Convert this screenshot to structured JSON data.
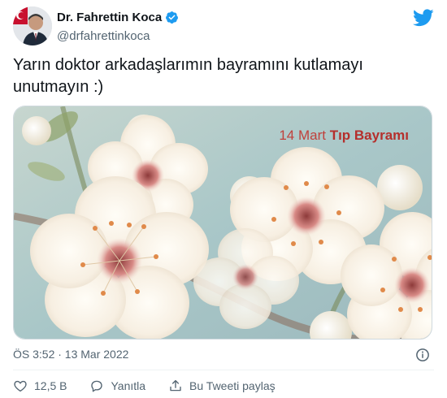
{
  "author": {
    "name": "Dr. Fahrettin Koca",
    "handle": "@drfahrettinkoca"
  },
  "tweet": {
    "text": "Yarın doktor arkadaşlarımın bayramını kutlamayı unutmayın :)"
  },
  "media": {
    "overlay_date": "14 Mart ",
    "overlay_title": "Tıp Bayramı"
  },
  "timestamp": "ÖS 3:52 · 13 Mar 2022",
  "actions": {
    "likes": "12,5 B",
    "reply_label": "Yanıtla",
    "share_label": "Bu Tweeti paylaş"
  },
  "colors": {
    "twitter_blue": "#1d9bf0",
    "text_primary": "#0f1419",
    "text_secondary": "#536471",
    "overlay_red": "#c0413c"
  },
  "icons": [
    "verified-badge-icon",
    "twitter-bird-icon",
    "info-icon",
    "heart-icon",
    "reply-icon",
    "share-icon"
  ]
}
